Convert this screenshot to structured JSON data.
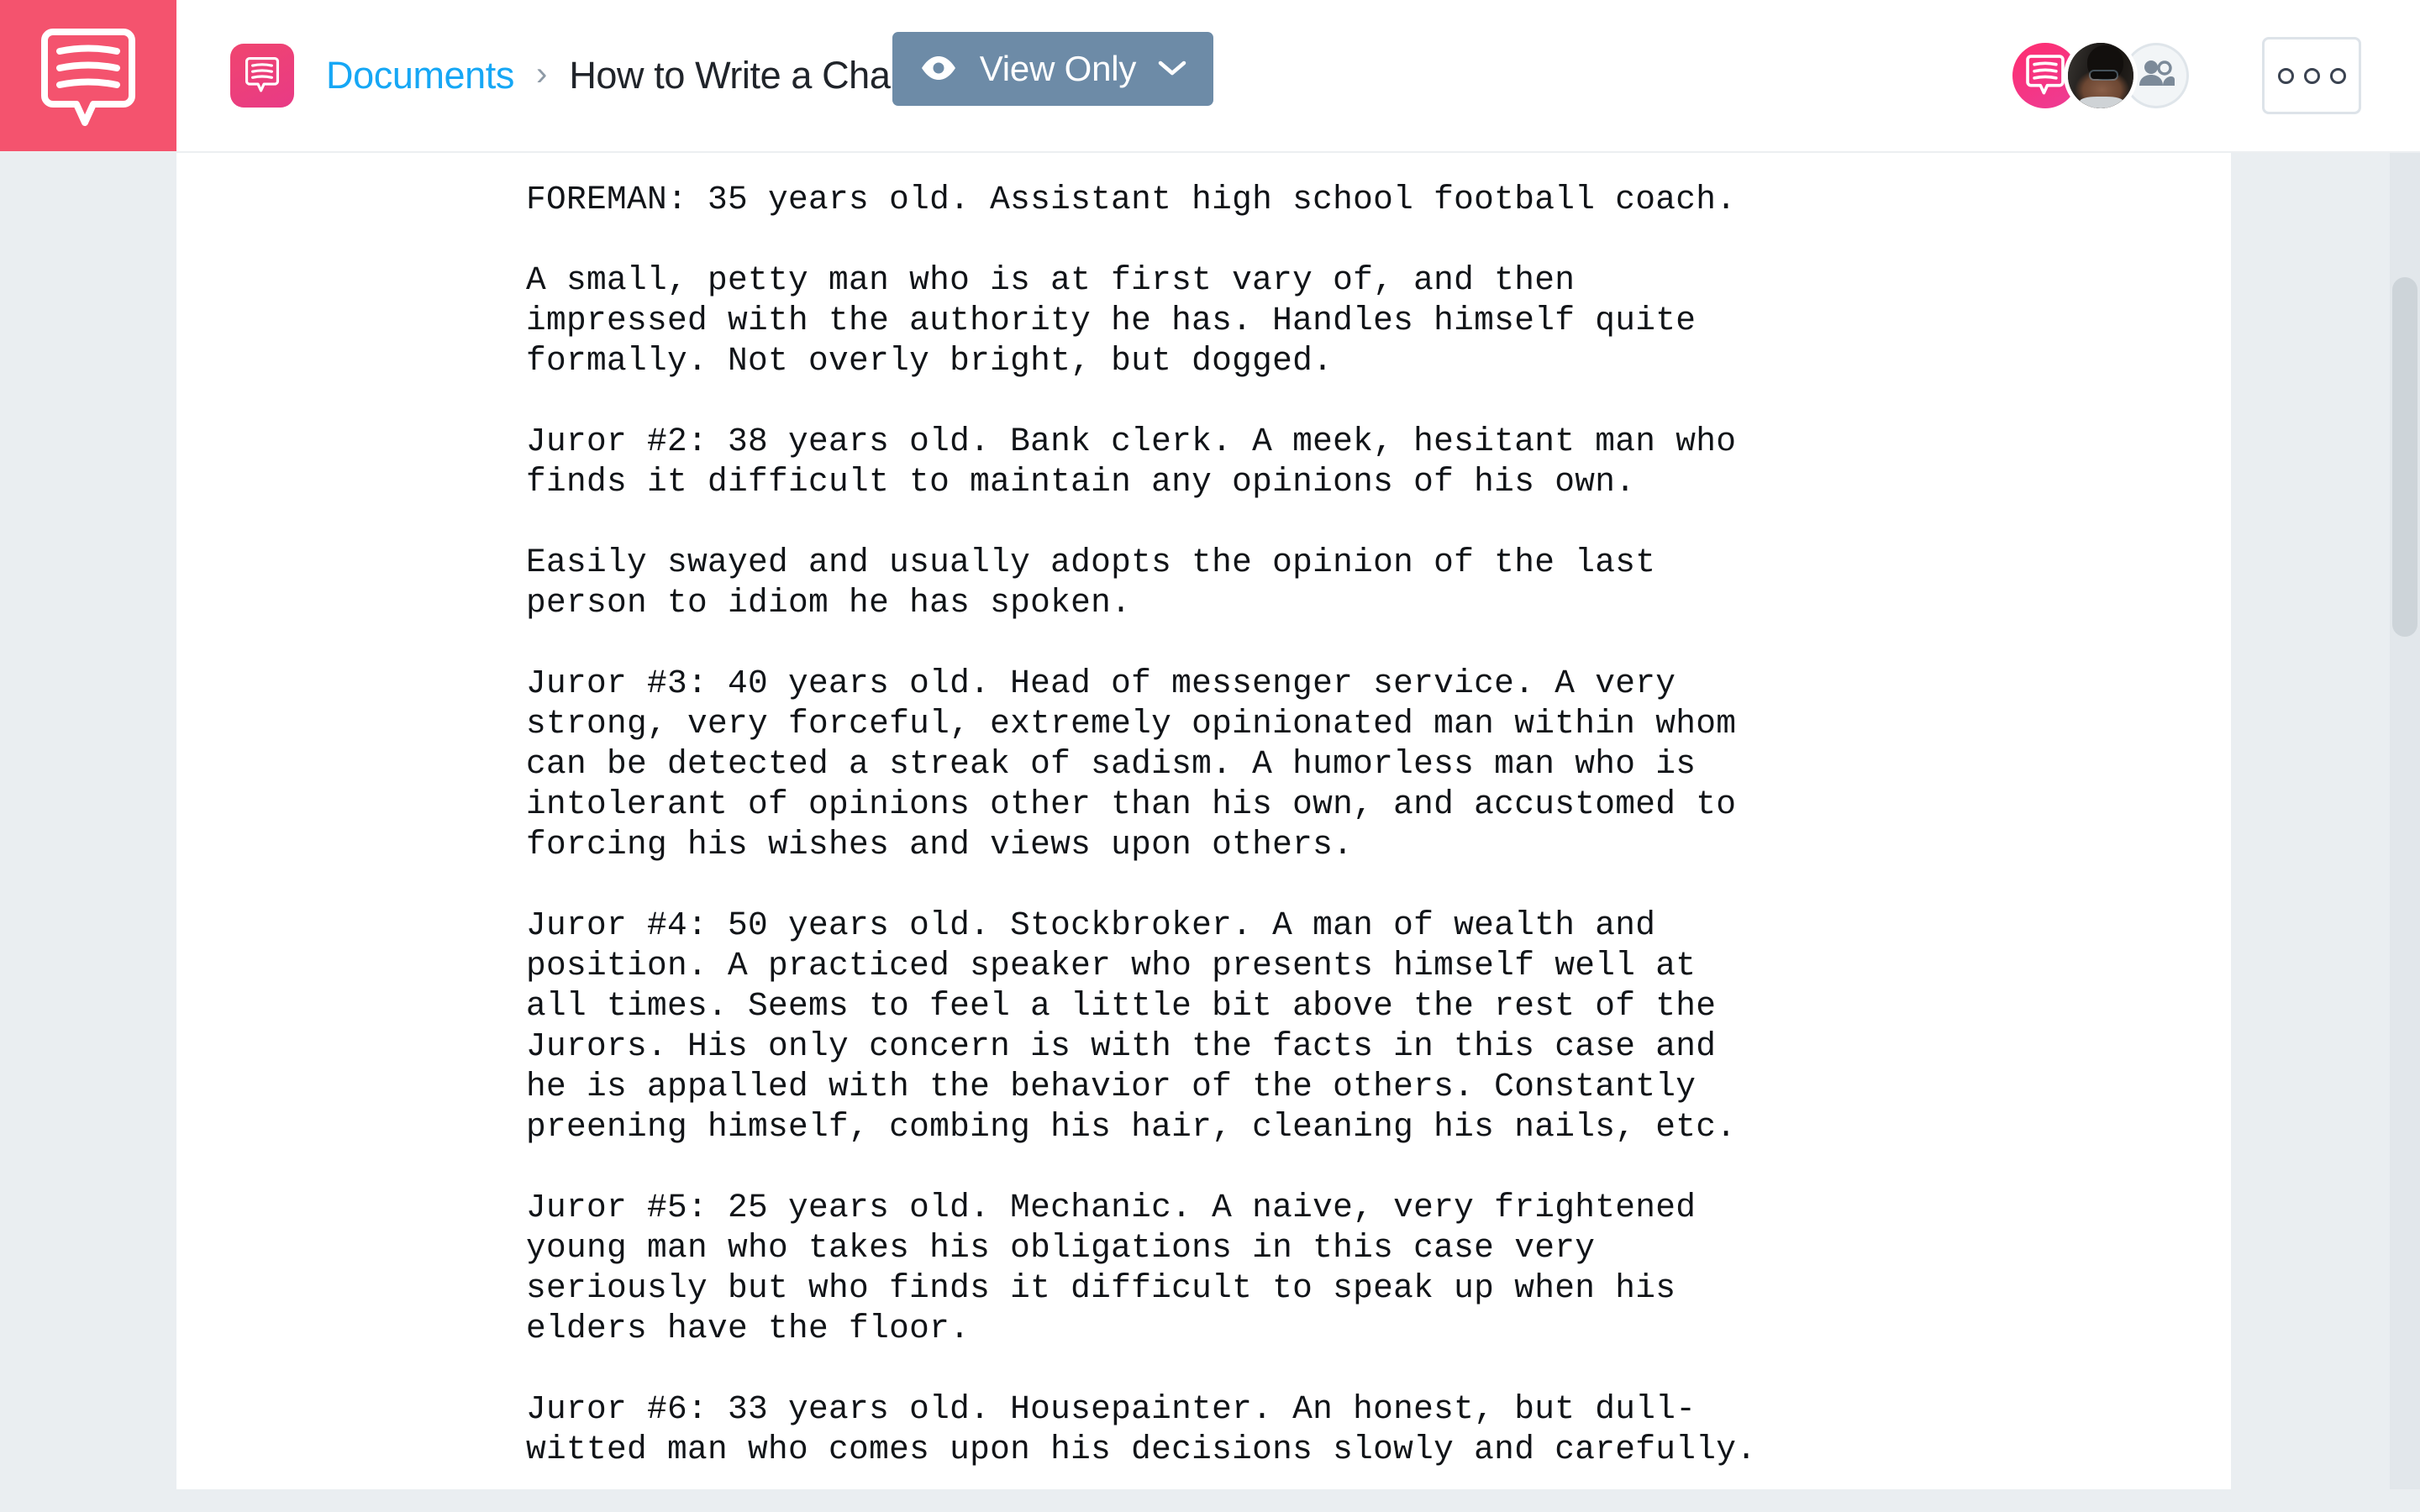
{
  "app": {
    "brand_color": "#f4536e",
    "accent_link_color": "#16a7f5",
    "view_button_color": "#6d8ba7",
    "logo_icon": "speech-bubble-lines-icon"
  },
  "topbar": {
    "logo_icon_name": "speech-bubble-lines-icon",
    "doc_chip_icon_name": "speech-bubble-lines-icon",
    "breadcrumb": {
      "root_label": "Documents",
      "separator": "›",
      "current_label": "How to Write a Cha.."
    },
    "view_mode_button": {
      "label": "View Only",
      "eye_icon": "eye-icon",
      "chevron_icon": "chevron-down-icon"
    },
    "avatars": [
      {
        "name": "brand-avatar",
        "icon": "speech-bubble-lines-icon",
        "type": "brand"
      },
      {
        "name": "collaborator-avatar",
        "icon": "user-photo",
        "type": "photo"
      },
      {
        "name": "add-collaborator-avatar",
        "icon": "people-icon",
        "type": "add"
      }
    ],
    "more_menu": {
      "icon": "three-circles-icon",
      "label": "ooo"
    }
  },
  "document": {
    "paragraphs": [
      "FOREMAN: 35 years old. Assistant high school football coach.",
      "A small, petty man who is at first vary of, and then\nimpressed with the authority he has. Handles himself quite\nformally. Not overly bright, but dogged.",
      "Juror #2: 38 years old. Bank clerk. A meek, hesitant man who\nfinds it difficult to maintain any opinions of his own.",
      "Easily swayed and usually adopts the opinion of the last\nperson to idiom he has spoken.",
      "Juror #3: 40 years old. Head of messenger service. A very\nstrong, very forceful, extremely opinionated man within whom\ncan be detected a streak of sadism. A humorless man who is\nintolerant of opinions other than his own, and accustomed to\nforcing his wishes and views upon others.",
      "Juror #4: 50 years old. Stockbroker. A man of wealth and\nposition. A practiced speaker who presents himself well at\nall times. Seems to feel a little bit above the rest of the\nJurors. His only concern is with the facts in this case and\nhe is appalled with the behavior of the others. Constantly\npreening himself, combing his hair, cleaning his nails, etc.",
      "Juror #5: 25 years old. Mechanic. A naive, very frightened\nyoung man who takes his obligations in this case very\nseriously but who finds it difficult to speak up when his\nelders have the floor.",
      "Juror #6: 33 years old. Housepainter. An honest, but dull-\nwitted man who comes upon his decisions slowly and carefully."
    ]
  },
  "scrollbar": {
    "name": "vertical-scrollbar"
  }
}
